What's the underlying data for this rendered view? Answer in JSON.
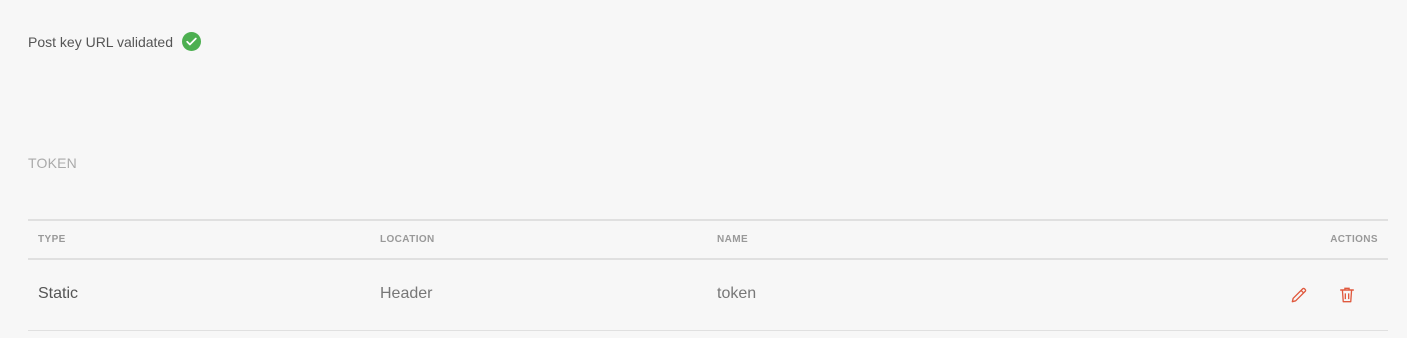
{
  "status": {
    "text": "Post key URL validated",
    "icon": "check-circle-icon",
    "color": "#4caf50"
  },
  "section": {
    "title": "TOKEN"
  },
  "table": {
    "columns": [
      "TYPE",
      "LOCATION",
      "NAME",
      "ACTIONS"
    ],
    "rows": [
      {
        "type": "Static",
        "location": "Header",
        "name": "token",
        "actions": [
          "edit-icon",
          "delete-icon"
        ]
      }
    ]
  },
  "colors": {
    "action": "#e0593e",
    "background": "#f7f7f7"
  }
}
